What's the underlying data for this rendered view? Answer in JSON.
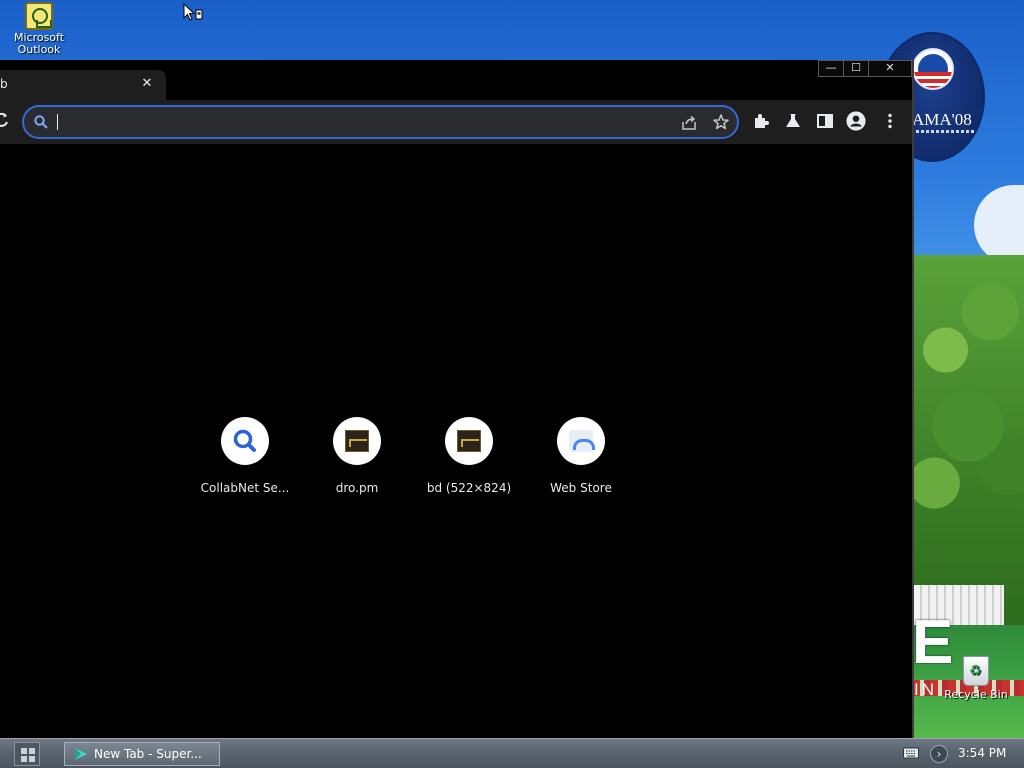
{
  "desktop": {
    "icons": [
      {
        "label": "Microsoft Outlook",
        "icon": "outlook-icon"
      },
      {
        "label": "Recycle Bin",
        "icon": "recycle-bin-icon"
      }
    ],
    "wallpaper": {
      "badge_text": "AMA'08",
      "big_text": "E",
      "small_text": "IN"
    }
  },
  "browser": {
    "tab": {
      "title": "b",
      "close": "✕"
    },
    "window_controls": {
      "minimize": "—",
      "maximize": "☐",
      "close": "✕"
    },
    "toolbar": {
      "reload_icon": "reload-icon",
      "omnibox": {
        "value": "",
        "placeholder": ""
      },
      "icons": [
        "share-icon",
        "bookmark-star-icon",
        "extensions-icon",
        "labs-flask-icon",
        "side-panel-icon",
        "profile-avatar-icon",
        "menu-kebab-icon"
      ]
    },
    "shortcuts": [
      {
        "label": "CollabNet Se...",
        "icon": "search-favicon"
      },
      {
        "label": "dro.pm",
        "icon": "image-favicon"
      },
      {
        "label": "bd (522×824)",
        "icon": "image-favicon"
      },
      {
        "label": "Web Store",
        "icon": "web-store-icon"
      }
    ]
  },
  "taskbar": {
    "task_item": "New Tab - Super...",
    "tray_arrow": "›",
    "clock": "3:54 PM"
  },
  "colors": {
    "accent_focus": "#3467d8",
    "browser_bg": "#000000",
    "toolbar_bg": "#1e1e1e",
    "text": "#e8eaed"
  }
}
